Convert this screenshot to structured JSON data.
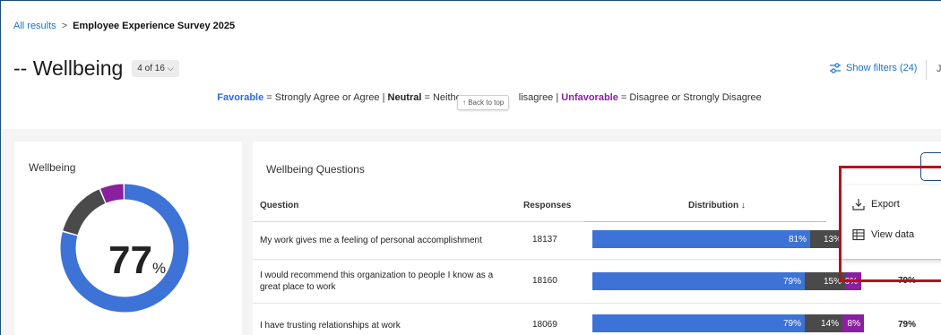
{
  "breadcrumb": {
    "root": "All results",
    "separator": ">",
    "current": "Employee Experience Survey 2025"
  },
  "header": {
    "title": "-- Wellbeing",
    "page_picker": "4 of 16",
    "show_filters": "Show filters (24)",
    "partial": "J"
  },
  "legend": {
    "favorable_label": "Favorable",
    "favorable_desc": " = Strongly Agree or Agree | ",
    "neutral_label": "Neutral",
    "neutral_desc": " = Neithe",
    "mid_desc": "lisagree | ",
    "unfavorable_label": "Unfavorable",
    "unfavorable_desc": " = Disagree or Strongly Disagree"
  },
  "back_to_top": "↑ Back to top",
  "summary_card": {
    "title": "Wellbeing",
    "score": "77",
    "unit": "%",
    "donut": {
      "favorable": 77,
      "neutral": 14,
      "unfavorable": 6
    }
  },
  "colors": {
    "favorable": "#3d72d6",
    "neutral": "#4a4a4a",
    "unfavorable": "#8a1fa0",
    "link": "#1a73c8",
    "highlight": "#b3121d"
  },
  "questions_card": {
    "title": "Wellbeing Questions",
    "columns": {
      "question": "Question",
      "responses": "Responses",
      "distribution": "Distribution ↓"
    },
    "rows": [
      {
        "question": "My work gives me a feeling of personal accomplishment",
        "responses": "18137",
        "fav": 81,
        "fav_label": "81%",
        "neu": 13,
        "neu_label": "13%",
        "unf": 0,
        "unf_label": "",
        "score": ""
      },
      {
        "question": "I would recommend this organization to people I know as a great place to work",
        "responses": "18160",
        "fav": 79,
        "fav_label": "79%",
        "neu": 15,
        "neu_label": "15%",
        "unf": 6,
        "unf_label": "6%",
        "score": "79%"
      },
      {
        "question": "I have trusting relationships at work",
        "responses": "18069",
        "fav": 79,
        "fav_label": "79%",
        "neu": 14,
        "neu_label": "14%",
        "unf": 8,
        "unf_label": "8%",
        "score": "79%"
      }
    ]
  },
  "menu": {
    "export": "Export",
    "view_data": "View data"
  }
}
